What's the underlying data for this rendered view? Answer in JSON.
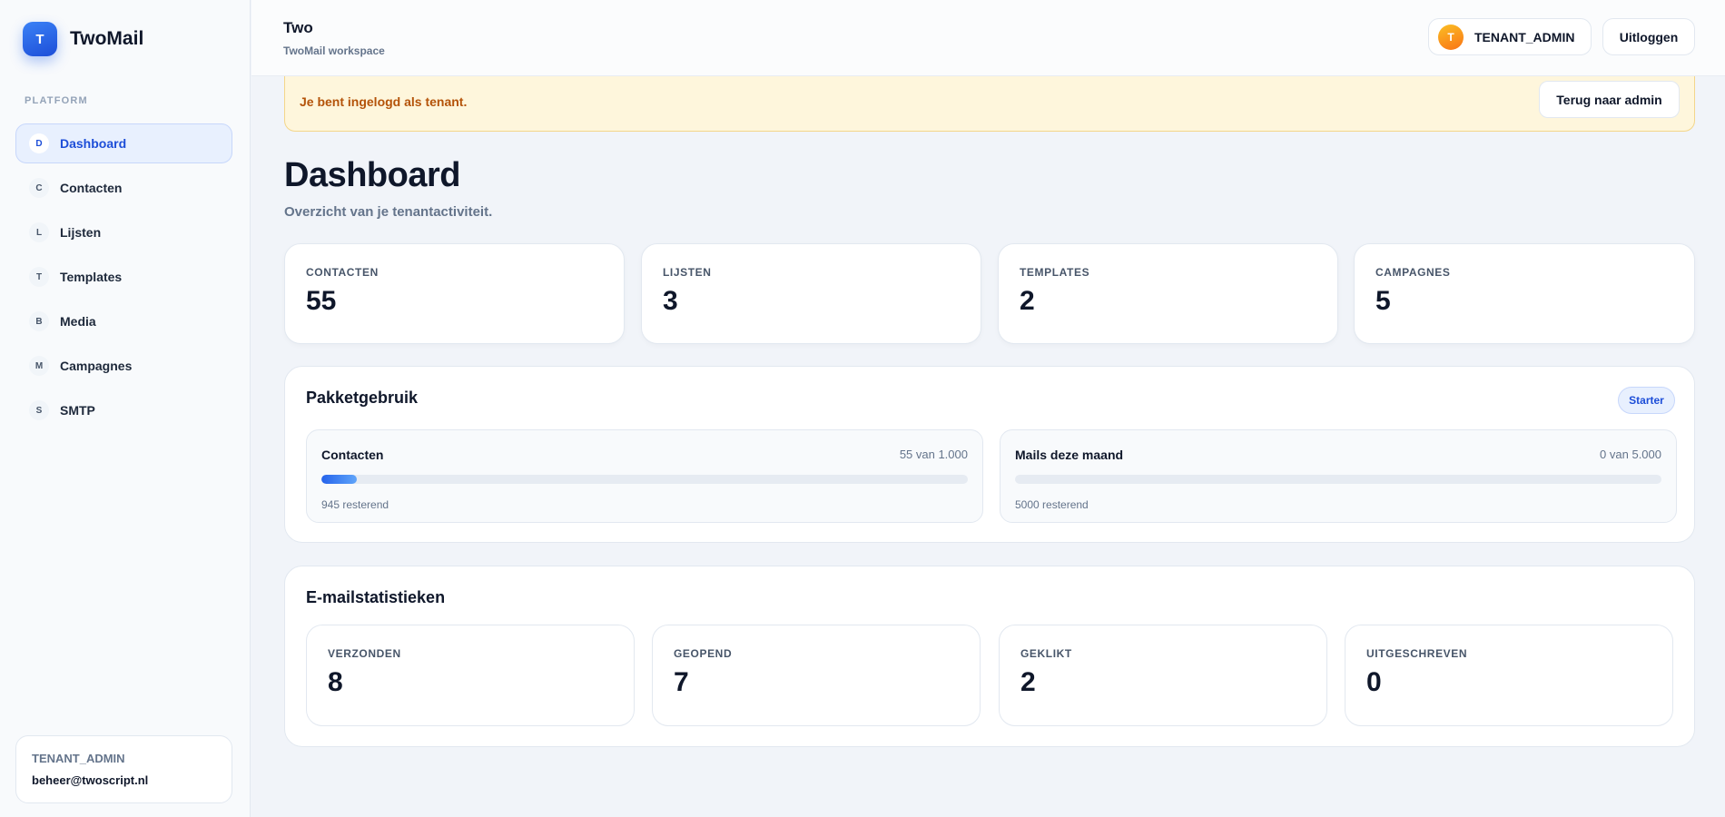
{
  "app": {
    "logo_letter": "T",
    "name": "TwoMail"
  },
  "sidebar": {
    "section_label": "PLATFORM",
    "items": [
      {
        "letter": "D",
        "label": "Dashboard",
        "active": true
      },
      {
        "letter": "C",
        "label": "Contacten"
      },
      {
        "letter": "L",
        "label": "Lijsten"
      },
      {
        "letter": "T",
        "label": "Templates"
      },
      {
        "letter": "B",
        "label": "Media"
      },
      {
        "letter": "M",
        "label": "Campagnes"
      },
      {
        "letter": "S",
        "label": "SMTP"
      }
    ],
    "user": {
      "role": "TENANT_ADMIN",
      "email": "beheer@twoscript.nl"
    }
  },
  "header": {
    "tenant_name": "Two",
    "tenant_subtitle": "TwoMail workspace",
    "role_initial": "T",
    "role_label": "TENANT_ADMIN",
    "logout_label": "Uitloggen"
  },
  "banner": {
    "message": "Je bent ingelogd als tenant.",
    "back_label": "Terug naar admin"
  },
  "page": {
    "title": "Dashboard",
    "subtitle": "Overzicht van je tenantactiviteit."
  },
  "stats": [
    {
      "label": "CONTACTEN",
      "value": "55"
    },
    {
      "label": "LIJSTEN",
      "value": "3"
    },
    {
      "label": "TEMPLATES",
      "value": "2"
    },
    {
      "label": "CAMPAGNES",
      "value": "5"
    }
  ],
  "usage": {
    "title": "Pakketgebruik",
    "plan": "Starter",
    "items": [
      {
        "name": "Contacten",
        "count": "55 van 1.000",
        "remaining": "945 resterend",
        "fraction": 0.055
      },
      {
        "name": "Mails deze maand",
        "count": "0 van 5.000",
        "remaining": "5000 resterend",
        "fraction": 0
      }
    ]
  },
  "email_stats": {
    "title": "E-mailstatistieken",
    "items": [
      {
        "label": "VERZONDEN",
        "value": "8"
      },
      {
        "label": "GEOPEND",
        "value": "7"
      },
      {
        "label": "GEKLIKT",
        "value": "2"
      },
      {
        "label": "UITGESCHREVEN",
        "value": "0"
      }
    ]
  },
  "colors": {
    "accent": "#2563eb",
    "warning_bg": "#fef6dc",
    "warning_text": "#b45309"
  }
}
